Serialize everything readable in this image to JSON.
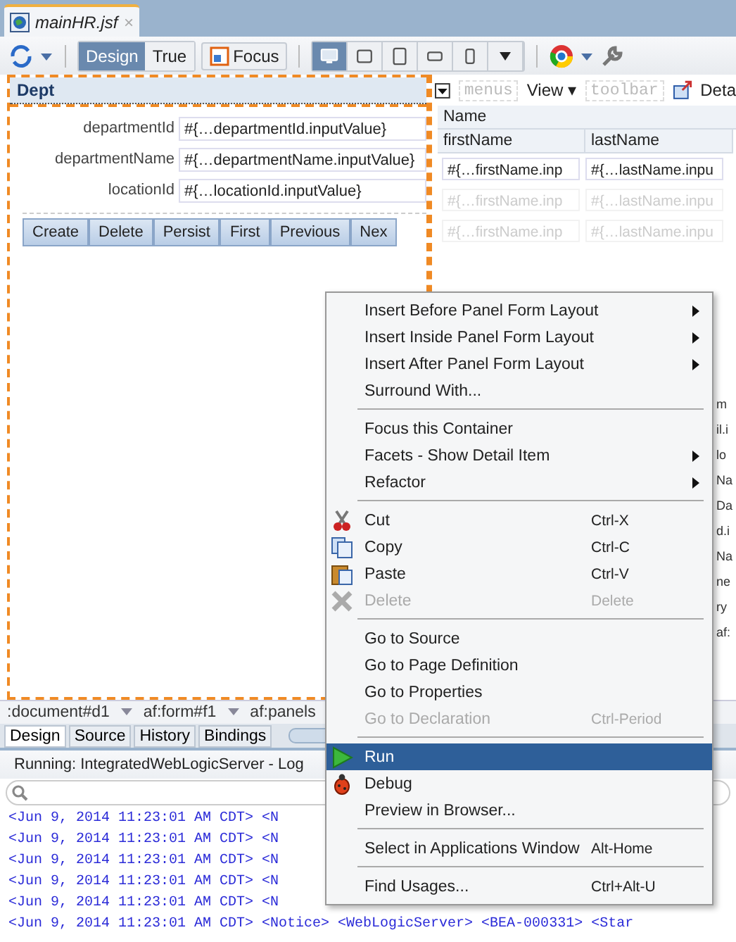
{
  "editor_tab": {
    "title": "mainHR.jsf",
    "close": "×"
  },
  "toolbar": {
    "modes": [
      {
        "label": "Design",
        "selected": true
      },
      {
        "label": "True",
        "selected": false
      }
    ],
    "focus_button": "Focus",
    "devices": [
      {
        "kind": "desktop",
        "selected": true
      },
      {
        "kind": "laptop",
        "selected": false
      },
      {
        "kind": "tablet",
        "selected": false
      },
      {
        "kind": "wide",
        "selected": false
      },
      {
        "kind": "phone",
        "selected": false
      }
    ]
  },
  "form_panel": {
    "title": "Dept",
    "fields": [
      {
        "label": "departmentId",
        "value": "#{…departmentId.inputValue}"
      },
      {
        "label": "departmentName",
        "value": "#{…departmentName.inputValue}"
      },
      {
        "label": "locationId",
        "value": "#{…locationId.inputValue}"
      }
    ],
    "buttons": [
      "Create",
      "Delete",
      "Persist",
      "First",
      "Previous",
      "Nex"
    ]
  },
  "table_panel": {
    "facets": [
      {
        "kind": "facet",
        "label": "menus"
      },
      {
        "kind": "menu",
        "label": "View",
        "caret": "▾"
      },
      {
        "kind": "facet",
        "label": "toolbar"
      },
      {
        "kind": "detach",
        "label": "Deta"
      }
    ],
    "group_header": "Name",
    "columns": [
      "firstName",
      "lastName"
    ],
    "rows": [
      {
        "disabled": false,
        "cells": [
          "#{…firstName.inp",
          "#{…lastName.inpu"
        ]
      },
      {
        "disabled": true,
        "cells": [
          "#{…firstName.inp",
          "#{…lastName.inpu"
        ]
      },
      {
        "disabled": true,
        "cells": [
          "#{…firstName.inp",
          "#{…lastName.inpu"
        ]
      }
    ]
  },
  "side_fragments": [
    "m",
    "il.i",
    "lo",
    "Na",
    "Da",
    "d.i",
    "Na",
    "ne",
    "ry",
    "af:"
  ],
  "breadcrumbs": [
    ":document#d1",
    "af:form#f1",
    "af:panels"
  ],
  "bottom_tabs": [
    {
      "label": "Design",
      "selected": true
    },
    {
      "label": "Source",
      "selected": false
    },
    {
      "label": "History",
      "selected": false
    },
    {
      "label": "Bindings",
      "selected": false
    }
  ],
  "log": {
    "title": "Running: IntegratedWebLogicServer - Log",
    "lines": [
      "<Jun 9, 2014 11:23:01 AM CDT> <N",
      "<Jun 9, 2014 11:23:01 AM CDT> <N",
      "<Jun 9, 2014 11:23:01 AM CDT> <N",
      "<Jun 9, 2014 11:23:01 AM CDT> <N",
      "<Jun 9, 2014 11:23:01 AM CDT> <N"
    ],
    "last_line": "<Jun 9, 2014 11:23:01 AM CDT> <Notice> <WebLogicServer> <BEA-000331> <Star"
  },
  "context_menu": {
    "items": [
      {
        "kind": "item",
        "label": "Insert Before Panel Form Layout",
        "submenu": true,
        "disabled": false,
        "selected": false
      },
      {
        "kind": "item",
        "label": "Insert Inside Panel Form Layout",
        "submenu": true,
        "disabled": false,
        "selected": false
      },
      {
        "kind": "item",
        "label": "Insert After Panel Form Layout",
        "submenu": true,
        "disabled": false,
        "selected": false
      },
      {
        "kind": "item",
        "label": "Surround With...",
        "submenu": false,
        "disabled": false,
        "selected": false
      },
      {
        "kind": "separator"
      },
      {
        "kind": "item",
        "label": "Focus this Container",
        "submenu": false,
        "disabled": false,
        "selected": false
      },
      {
        "kind": "item",
        "label": "Facets - Show Detail Item",
        "submenu": true,
        "disabled": false,
        "selected": false
      },
      {
        "kind": "item",
        "label": "Refactor",
        "submenu": true,
        "disabled": false,
        "selected": false
      },
      {
        "kind": "separator"
      },
      {
        "kind": "cut",
        "label": "Cut",
        "shortcut": "Ctrl-X",
        "submenu": false,
        "disabled": false,
        "selected": false
      },
      {
        "kind": "copy",
        "label": "Copy",
        "shortcut": "Ctrl-C",
        "submenu": false,
        "disabled": false,
        "selected": false
      },
      {
        "kind": "paste",
        "label": "Paste",
        "shortcut": "Ctrl-V",
        "submenu": false,
        "disabled": false,
        "selected": false
      },
      {
        "kind": "delete",
        "label": "Delete",
        "shortcut": "Delete",
        "submenu": false,
        "disabled": true,
        "selected": false
      },
      {
        "kind": "separator"
      },
      {
        "kind": "item",
        "label": "Go to Source",
        "submenu": false,
        "disabled": false,
        "selected": false
      },
      {
        "kind": "item",
        "label": "Go to Page Definition",
        "submenu": false,
        "disabled": false,
        "selected": false
      },
      {
        "kind": "item",
        "label": "Go to Properties",
        "submenu": false,
        "disabled": false,
        "selected": false
      },
      {
        "kind": "item",
        "label": "Go to Declaration",
        "shortcut": "Ctrl-Period",
        "submenu": false,
        "disabled": true,
        "selected": false
      },
      {
        "kind": "separator"
      },
      {
        "kind": "run",
        "label": "Run",
        "submenu": false,
        "disabled": false,
        "selected": true
      },
      {
        "kind": "debug",
        "label": "Debug",
        "submenu": false,
        "disabled": false,
        "selected": false
      },
      {
        "kind": "item",
        "label": "Preview in Browser...",
        "submenu": false,
        "disabled": false,
        "selected": false
      },
      {
        "kind": "separator"
      },
      {
        "kind": "item",
        "label": "Select in Applications Window",
        "shortcut": "Alt-Home",
        "submenu": false,
        "disabled": false,
        "selected": false
      },
      {
        "kind": "separator"
      },
      {
        "kind": "item",
        "label": "Find Usages...",
        "shortcut": "Ctrl+Alt-U",
        "submenu": false,
        "disabled": false,
        "selected": false
      }
    ]
  }
}
